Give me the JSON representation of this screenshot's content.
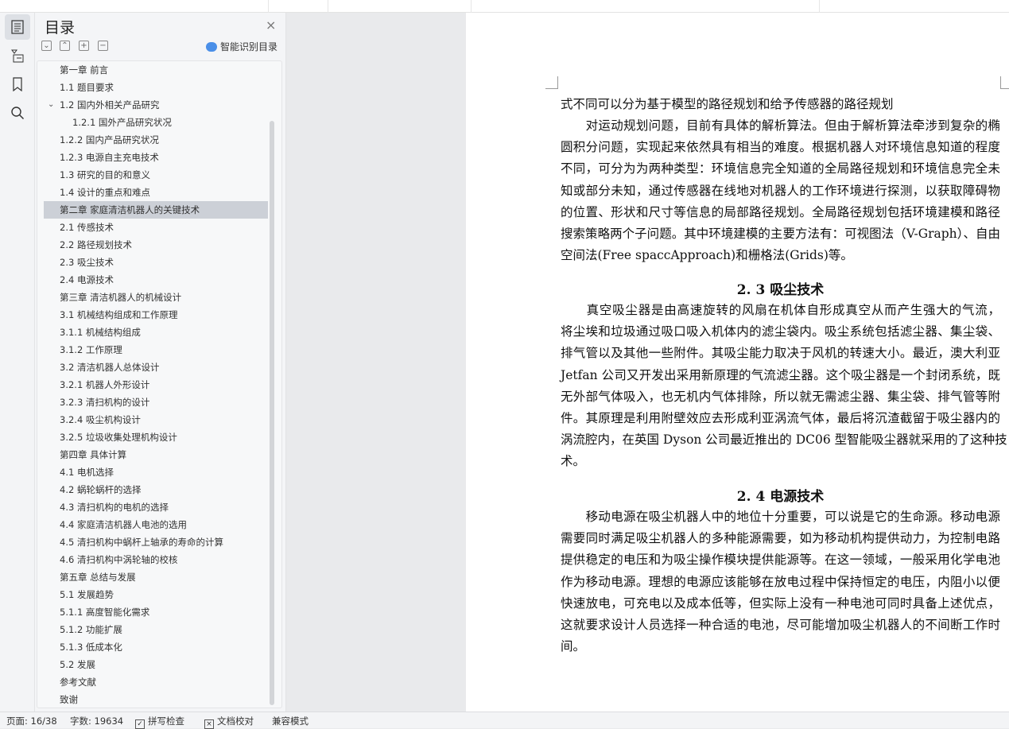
{
  "panel": {
    "title": "目录",
    "smart_label": "智能识别目录",
    "close": "×"
  },
  "toc": [
    {
      "label": "第一章  前言",
      "level": 0
    },
    {
      "label": "1.1 题目要求",
      "level": 0
    },
    {
      "label": "1.2 国内外相关产品研究",
      "level": 0,
      "expanded": true
    },
    {
      "label": "1.2.1 国外产品研究状况",
      "level": 1
    },
    {
      "label": "1.2.2 国内产品研究状况",
      "level": 0
    },
    {
      "label": "1.2.3 电源自主充电技术",
      "level": 0
    },
    {
      "label": "1.3 研究的目的和意义",
      "level": 0
    },
    {
      "label": "1.4 设计的重点和难点",
      "level": 0
    },
    {
      "label": "第二章  家庭清洁机器人的关键技术",
      "level": 0,
      "selected": true
    },
    {
      "label": "2.1 传感技术",
      "level": 0
    },
    {
      "label": "2.2 路径规划技术",
      "level": 0
    },
    {
      "label": "2.3 吸尘技术",
      "level": 0
    },
    {
      "label": "2.4 电源技术",
      "level": 0
    },
    {
      "label": "第三章  清洁机器人的机械设计",
      "level": 0
    },
    {
      "label": "3.1 机械结构组成和工作原理",
      "level": 0
    },
    {
      "label": "3.1.1    机械结构组成",
      "level": 0
    },
    {
      "label": "3.1.2 工作原理",
      "level": 0
    },
    {
      "label": "3.2 清洁机器人总体设计",
      "level": 0
    },
    {
      "label": "3.2.1 机器人外形设计",
      "level": 0
    },
    {
      "label": "3.2.3  清扫机构的设计",
      "level": 0
    },
    {
      "label": "3.2.4 吸尘机构设计",
      "level": 0
    },
    {
      "label": "3.2.5 垃圾收集处理机构设计",
      "level": 0
    },
    {
      "label": "第四章  具体计算",
      "level": 0
    },
    {
      "label": "4.1 电机选择",
      "level": 0
    },
    {
      "label": "4.2 蜗轮蜗杆的选择",
      "level": 0
    },
    {
      "label": "4.3 清扫机构的电机的选择",
      "level": 0
    },
    {
      "label": "4.4 家庭清洁机器人电池的选用",
      "level": 0
    },
    {
      "label": "4.5 清扫机构中蜗杆上轴承的寿命的计算",
      "level": 0
    },
    {
      "label": "4.6  清扫机构中涡轮轴的校核",
      "level": 0
    },
    {
      "label": "第五章  总结与发展",
      "level": 0
    },
    {
      "label": "5.1 发展趋势",
      "level": 0
    },
    {
      "label": "5.1.1 高度智能化需求",
      "level": 0
    },
    {
      "label": "5.1.2 功能扩展",
      "level": 0
    },
    {
      "label": "5.1.3  低成本化",
      "level": 0
    },
    {
      "label": "5.2 发展",
      "level": 0
    },
    {
      "label": "参考文献",
      "level": 0
    },
    {
      "label": "致谢",
      "level": 0
    }
  ],
  "document": {
    "p1": [
      "式不同可以分为基于模型的路径规划和给予传感器的路径规划"
    ],
    "p2": [
      "　　对运动规划问题，目前有具体的解析算法。但由于解析算法牵涉到复杂的椭",
      "圆积分问题，实现起来依然具有相当的难度。根据机器人对环境信息知道的程度",
      "不同，可分为为两种类型：环境信息完全知道的全局路径规划和环境信息完全未",
      "知或部分未知，通过传感器在线地对机器人的工作环境进行探测，以获取障碍物",
      "的位置、形状和尺寸等信息的局部路径规划。全局路径规划包括环境建模和路径",
      "搜索策略两个子问题。其中环境建模的主要方法有：可视图法（V-Graph）、自由",
      "空间法(Free spaccApproach)和栅格法(Grids)等。"
    ],
    "h1": "2. 3 吸尘技术",
    "p3": [
      "　　真空吸尘器是由高速旋转的风扇在机体自形成真空从而产生强大的气流，",
      "将尘埃和垃圾通过吸口吸入机体内的滤尘袋内。吸尘系统包括滤尘器、集尘袋、",
      "排气管以及其他一些附件。其吸尘能力取决于风机的转速大小。最近，澳大利亚",
      "Jetfan 公司又开发出采用新原理的气流滤尘器。这个吸尘器是一个封闭系统，既",
      "无外部气体吸入，也无机内气体排除，所以就无需滤尘器、集尘袋、排气管等附",
      "件。其原理是利用附壁效应去形成利亚涡流气体，最后将沉渣截留于吸尘器内的",
      "涡流腔内，在英国 Dyson 公司最近推出的 DC06 型智能吸尘器就采用的了这种技",
      "术。"
    ],
    "h2": "2. 4 电源技术",
    "p4": [
      "　　移动电源在吸尘机器人中的地位十分重要，可以说是它的生命源。移动电源",
      "需要同时满足吸尘机器人的多种能源需要，如为移动机构提供动力，为控制电路",
      "提供稳定的电压和为吸尘操作模块提供能源等。在这一领域，一般采用化学电池",
      "作为移动电源。理想的电源应该能够在放电过程中保持恒定的电压，内阻小以便",
      "快速放电，可充电以及成本低等，但实际上没有一种电池可同时具备上述优点，",
      "这就要求设计人员选择一种合适的电池，尽可能增加吸尘机器人的不间断工作时",
      "间。"
    ]
  },
  "status": {
    "page": "页面: 16/38",
    "words": "字数: 19634",
    "spell": "拼写检查",
    "proof": "文档校对",
    "compat": "兼容模式"
  }
}
